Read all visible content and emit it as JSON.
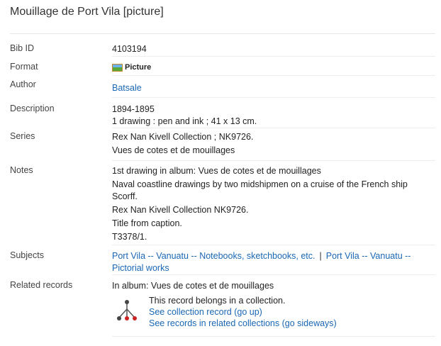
{
  "title": "Mouillage de Port Vila [picture]",
  "fields": {
    "bib_id": {
      "label": "Bib ID",
      "value": "4103194"
    },
    "format": {
      "label": "Format",
      "value": "Picture",
      "icon": "picture-icon"
    },
    "author": {
      "label": "Author",
      "value": "Batsale"
    },
    "description": {
      "label": "Description",
      "lines": [
        "1894-1895",
        "1 drawing : pen and ink ; 41 x 13 cm."
      ]
    },
    "series": {
      "label": "Series",
      "lines": [
        "Rex Nan Kivell Collection ; NK9726.",
        "Vues de cotes et de mouillages"
      ]
    },
    "notes": {
      "label": "Notes",
      "lines": [
        "1st drawing in album: Vues de cotes et de mouillages",
        "Naval coastline drawings by two midshipmen on a cruise of the French ship",
        "Scorff.",
        "Rex Nan Kivell Collection NK9726.",
        "Title from caption.",
        "T3378/1."
      ]
    },
    "subjects": {
      "label": "Subjects",
      "links": [
        "Port Vila -- Vanuatu -- Notebooks, sketchbooks, etc.",
        "Port Vila -- Vanuatu -- Pictorial works"
      ],
      "separator": "|"
    },
    "related": {
      "label": "Related records",
      "album": "In album: Vues de cotes et de mouillages",
      "collection_note": "This record belongs in a collection.",
      "collection_link": "See collection record (go up)",
      "related_link": "See records in related collections (go sideways)",
      "icon": "collection-tree-icon"
    }
  }
}
